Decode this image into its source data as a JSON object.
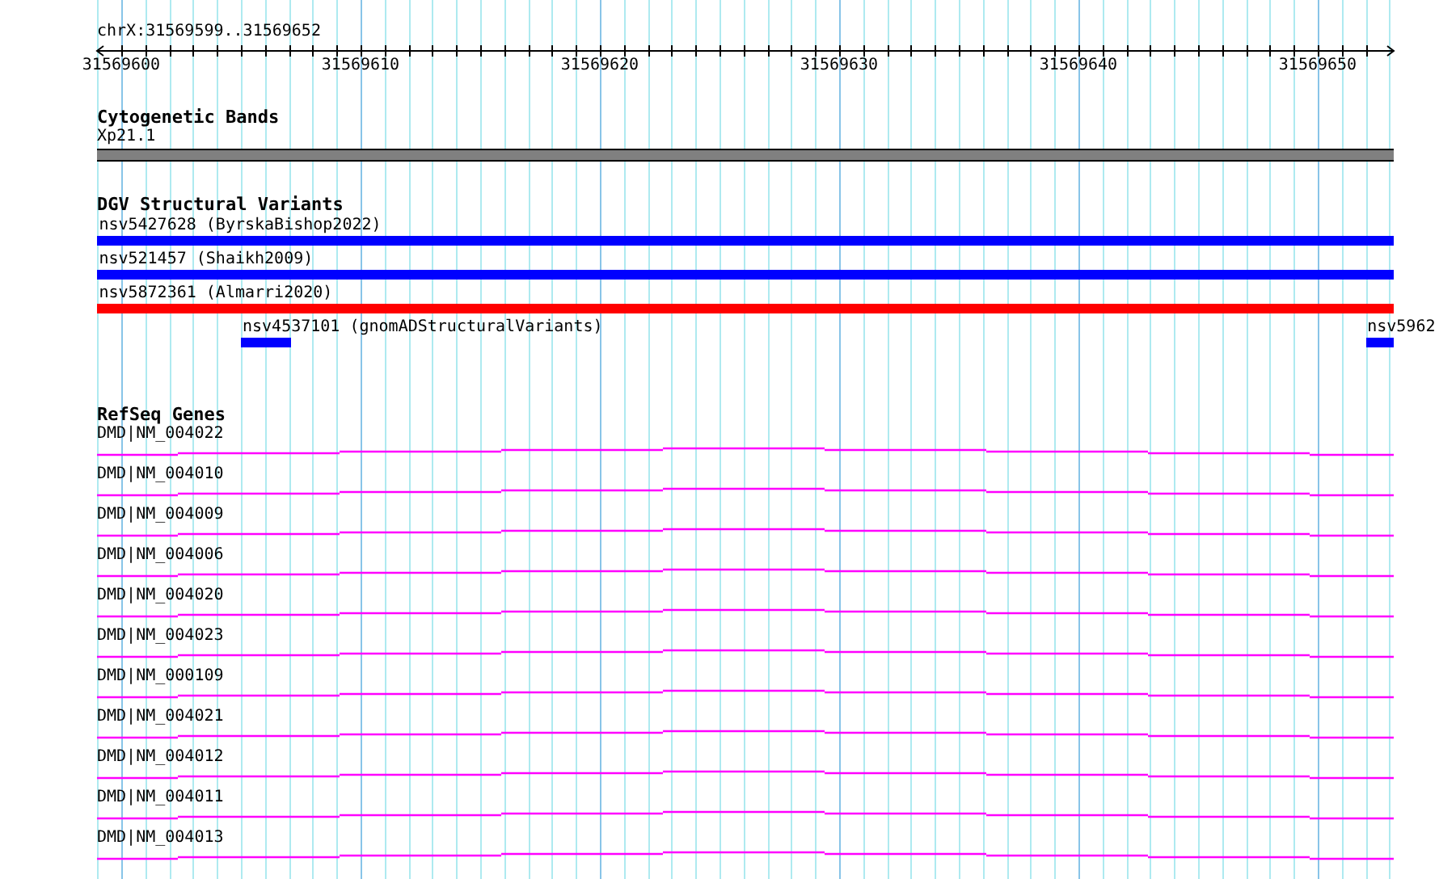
{
  "ruler": {
    "region": "chrX:31569599..31569652",
    "ticks": [
      "31569600",
      "31569610",
      "31569620",
      "31569630",
      "31569640",
      "31569650"
    ]
  },
  "tracks": [
    {
      "kind": "bands",
      "title": "Cytogenetic Bands",
      "features": [
        {
          "label": "Xp21.1",
          "color": "#808080"
        }
      ]
    },
    {
      "kind": "variants",
      "title": "DGV Structural Variants",
      "rows": [
        [
          {
            "label": "nsv5427628 (ByrskaBishop2022)",
            "color": "#0000ff"
          }
        ],
        [
          {
            "label": "nsv521457 (Shaikh2009)",
            "color": "#0000ff"
          }
        ],
        [
          {
            "label": "nsv5872361 (Almarri2020)",
            "color": "#ff0000"
          }
        ],
        [
          {
            "label": "nsv4537101 (gnomADStructuralVariants)",
            "color": "#0000ff"
          },
          {
            "label": "nsv5962",
            "color": "#0000ff"
          }
        ]
      ]
    },
    {
      "kind": "genes",
      "title": "RefSeq Genes",
      "genes": [
        "DMD|NM_004022",
        "DMD|NM_004010",
        "DMD|NM_004009",
        "DMD|NM_004006",
        "DMD|NM_004020",
        "DMD|NM_004023",
        "DMD|NM_000109",
        "DMD|NM_004021",
        "DMD|NM_004012",
        "DMD|NM_004011",
        "DMD|NM_004013"
      ]
    }
  ]
}
